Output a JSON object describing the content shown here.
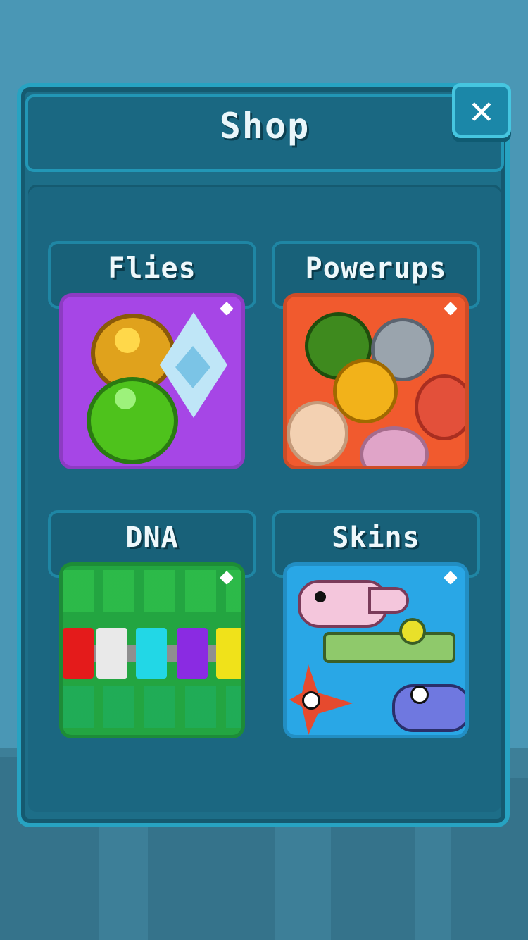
{
  "screen": {
    "title": "Shop",
    "close_symbol": "✕"
  },
  "categories": [
    {
      "label": "Flies",
      "icon": "flies-icon",
      "tile_color": "#a646e6"
    },
    {
      "label": "Powerups",
      "icon": "powerups-icon",
      "tile_color": "#f15a2e"
    },
    {
      "label": "DNA",
      "icon": "dna-icon",
      "tile_color": "#23a541"
    },
    {
      "label": "Skins",
      "icon": "skins-icon",
      "tile_color": "#29a7e6"
    }
  ],
  "colors": {
    "background": "#4a97b5",
    "panel": "#1d6e88",
    "panel_border": "#27a3c2",
    "text": "#e9f6fa"
  }
}
